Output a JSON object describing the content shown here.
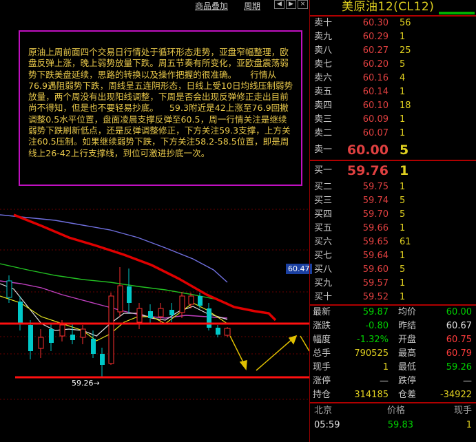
{
  "toolbar": {
    "link1": "商品叠加",
    "link2": "周期"
  },
  "note": "原油上周前面四个交易日行情处于循环形态走势，亚盘窄幅整理，欧盘反弹上涨，晚上弱势放量下跌。周五节奏有所变化，亚欧盘震荡弱势下跌美盘延续，思路的转换以及操作把握的很准确。     行情从76.9遇阻弱势下跌，周线呈五连阴形态，日线上受10日均线压制弱势放量，两个周没有出现阳线调整，下周是否会出现反弹修正走出目前尚不得知，但是也不要轻易抄底。    59.3附近是42上涨至76.9回撤调整0.5水平位置，盘面凌晨支撑反弹至60.5，周一行情关注是继续弱势下跌刷新低点，还是反弹调整修正，下方关注59.3支撑，上方关注60.5压制。如果继续弱势下跌，下方关注58.2-58.5位置，即是周线上26-42上行支撑线，到位可激进抄底一次。",
  "chart": {
    "price_tag": "60.47",
    "low_label": "59.26→"
  },
  "panel": {
    "title": "美原油12(CL12)",
    "asks": [
      {
        "label": "卖十",
        "price": "60.30",
        "vol": "56"
      },
      {
        "label": "卖九",
        "price": "60.29",
        "vol": "1"
      },
      {
        "label": "卖八",
        "price": "60.27",
        "vol": "25"
      },
      {
        "label": "卖七",
        "price": "60.20",
        "vol": "5"
      },
      {
        "label": "卖六",
        "price": "60.16",
        "vol": "4"
      },
      {
        "label": "卖五",
        "price": "60.14",
        "vol": "1"
      },
      {
        "label": "卖四",
        "price": "60.10",
        "vol": "18"
      },
      {
        "label": "卖三",
        "price": "60.09",
        "vol": "1"
      },
      {
        "label": "卖二",
        "price": "60.07",
        "vol": "1"
      },
      {
        "label": "卖一",
        "price": "60.00",
        "vol": "5"
      }
    ],
    "bids": [
      {
        "label": "买一",
        "price": "59.76",
        "vol": "1"
      },
      {
        "label": "买二",
        "price": "59.75",
        "vol": "1"
      },
      {
        "label": "买三",
        "price": "59.74",
        "vol": "5"
      },
      {
        "label": "买四",
        "price": "59.70",
        "vol": "5"
      },
      {
        "label": "买五",
        "price": "59.66",
        "vol": "1"
      },
      {
        "label": "买六",
        "price": "59.65",
        "vol": "61"
      },
      {
        "label": "买七",
        "price": "59.64",
        "vol": "1"
      },
      {
        "label": "买八",
        "price": "59.60",
        "vol": "5"
      },
      {
        "label": "买九",
        "price": "59.57",
        "vol": "1"
      },
      {
        "label": "买十",
        "price": "59.52",
        "vol": "1"
      }
    ],
    "stats": [
      {
        "k1": "最新",
        "v1": "59.87",
        "c1": "green",
        "k2": "均价",
        "v2": "60.00",
        "c2": "green"
      },
      {
        "k1": "涨跌",
        "v1": "-0.80",
        "c1": "green",
        "k2": "昨结",
        "v2": "60.67",
        "c2": "white"
      },
      {
        "k1": "幅度",
        "v1": "-1.32%",
        "c1": "green",
        "k2": "开盘",
        "v2": "60.75",
        "c2": "red"
      },
      {
        "k1": "总手",
        "v1": "790525",
        "c1": "yellow",
        "k2": "最高",
        "v2": "60.79",
        "c2": "red"
      },
      {
        "k1": "现手",
        "v1": "1",
        "c1": "yellow",
        "k2": "最低",
        "v2": "59.26",
        "c2": "green"
      },
      {
        "k1": "涨停",
        "v1": "—",
        "c1": "white",
        "k2": "跌停",
        "v2": "—",
        "c2": "white"
      },
      {
        "k1": "持仓",
        "v1": "314185",
        "c1": "yellow",
        "k2": "仓差",
        "v2": "-34922",
        "c2": "yellow"
      }
    ],
    "ticks_header": {
      "c1": "北京",
      "c2": "价格",
      "c3": "现手"
    },
    "ticks": [
      {
        "time": "05:59",
        "price": "59.83",
        "vol": "1"
      }
    ]
  }
}
